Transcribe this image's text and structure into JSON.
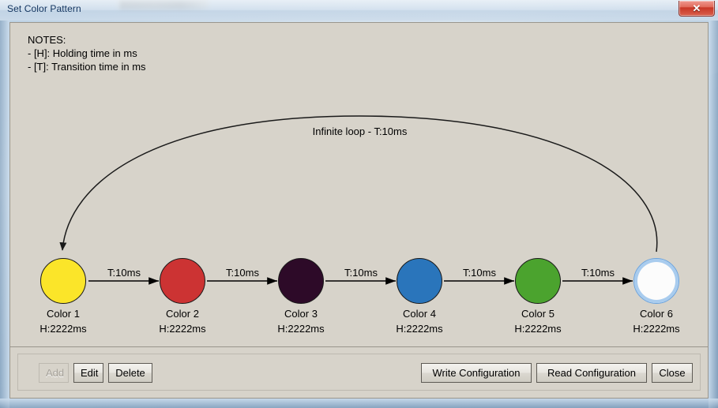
{
  "window": {
    "title": "Set Color Pattern",
    "close_icon": "close-icon",
    "close_label": "✕"
  },
  "notes": {
    "heading": "NOTES:",
    "line1": "- [H]: Holding time in ms",
    "line2": "- [T]: Transition time in ms",
    "text": "NOTES:\n- [H]: Holding time in ms\n- [T]: Transition time in ms"
  },
  "diagram": {
    "loop_label": "Infinite loop - T:10ms",
    "nodes": [
      {
        "name": "Color 1",
        "hold": "H:2222ms",
        "color": "#fbe529",
        "stroke": "#1a1a1a",
        "selected": false
      },
      {
        "name": "Color 2",
        "hold": "H:2222ms",
        "color": "#cc3333",
        "stroke": "#1a1a1a",
        "selected": false
      },
      {
        "name": "Color 3",
        "hold": "H:2222ms",
        "color": "#2d0a28",
        "stroke": "#1a1a1a",
        "selected": false
      },
      {
        "name": "Color 4",
        "hold": "H:2222ms",
        "color": "#2a75bb",
        "stroke": "#1a1a1a",
        "selected": false
      },
      {
        "name": "Color 5",
        "hold": "H:2222ms",
        "color": "#4ba32e",
        "stroke": "#1a1a1a",
        "selected": false
      },
      {
        "name": "Color 6",
        "hold": "H:2222ms",
        "color": "#fcfcfc",
        "stroke": "#6ba3dd",
        "selected": true
      }
    ],
    "transitions": [
      {
        "label": "T:10ms"
      },
      {
        "label": "T:10ms"
      },
      {
        "label": "T:10ms"
      },
      {
        "label": "T:10ms"
      },
      {
        "label": "T:10ms"
      }
    ]
  },
  "buttons": {
    "add": {
      "label": "Add",
      "enabled": false
    },
    "edit": {
      "label": "Edit",
      "enabled": true
    },
    "delete": {
      "label": "Delete",
      "enabled": true
    },
    "write_configuration": {
      "label": "Write Configuration",
      "enabled": true
    },
    "read_configuration": {
      "label": "Read Configuration",
      "enabled": true
    },
    "close": {
      "label": "Close",
      "enabled": true
    }
  }
}
